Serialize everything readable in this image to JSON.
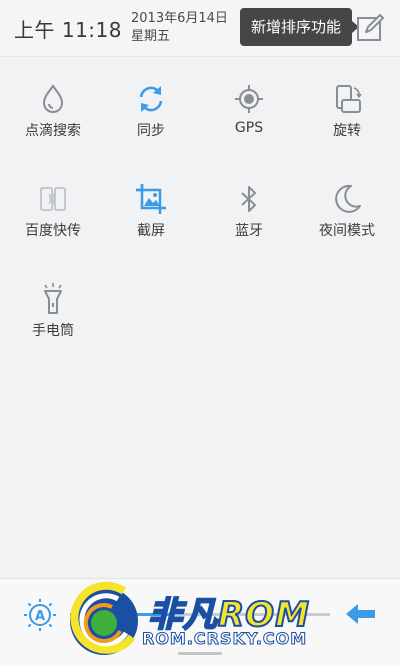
{
  "status": {
    "time": "上午 11:18",
    "date": "2013年6月14日",
    "weekday": "星期五",
    "tooltip": "新增排序功能"
  },
  "tiles": [
    {
      "label": "点滴搜索",
      "icon": "droplet-icon",
      "active": false
    },
    {
      "label": "同步",
      "icon": "sync-icon",
      "active": true
    },
    {
      "label": "GPS",
      "icon": "gps-icon",
      "active": false
    },
    {
      "label": "旋转",
      "icon": "rotate-icon",
      "active": false
    },
    {
      "label": "百度快传",
      "icon": "baidu-transfer-icon",
      "active": false
    },
    {
      "label": "截屏",
      "icon": "screenshot-icon",
      "active": true
    },
    {
      "label": "蓝牙",
      "icon": "bluetooth-icon",
      "active": false
    },
    {
      "label": "夜间模式",
      "icon": "moon-icon",
      "active": false
    },
    {
      "label": "手电筒",
      "icon": "flashlight-icon",
      "active": false
    }
  ],
  "bottom": {
    "brightness_icon": "auto-brightness-icon",
    "back_icon": "back-arrow-icon"
  },
  "watermark": {
    "cn": "非凡",
    "rom": "ROM",
    "url": "ROM.CRSKY.COM"
  },
  "colors": {
    "accent": "#3c9be6",
    "icon_gray": "#8a8d92",
    "tooltip_bg": "#464646",
    "background": "#f1f2f4"
  }
}
